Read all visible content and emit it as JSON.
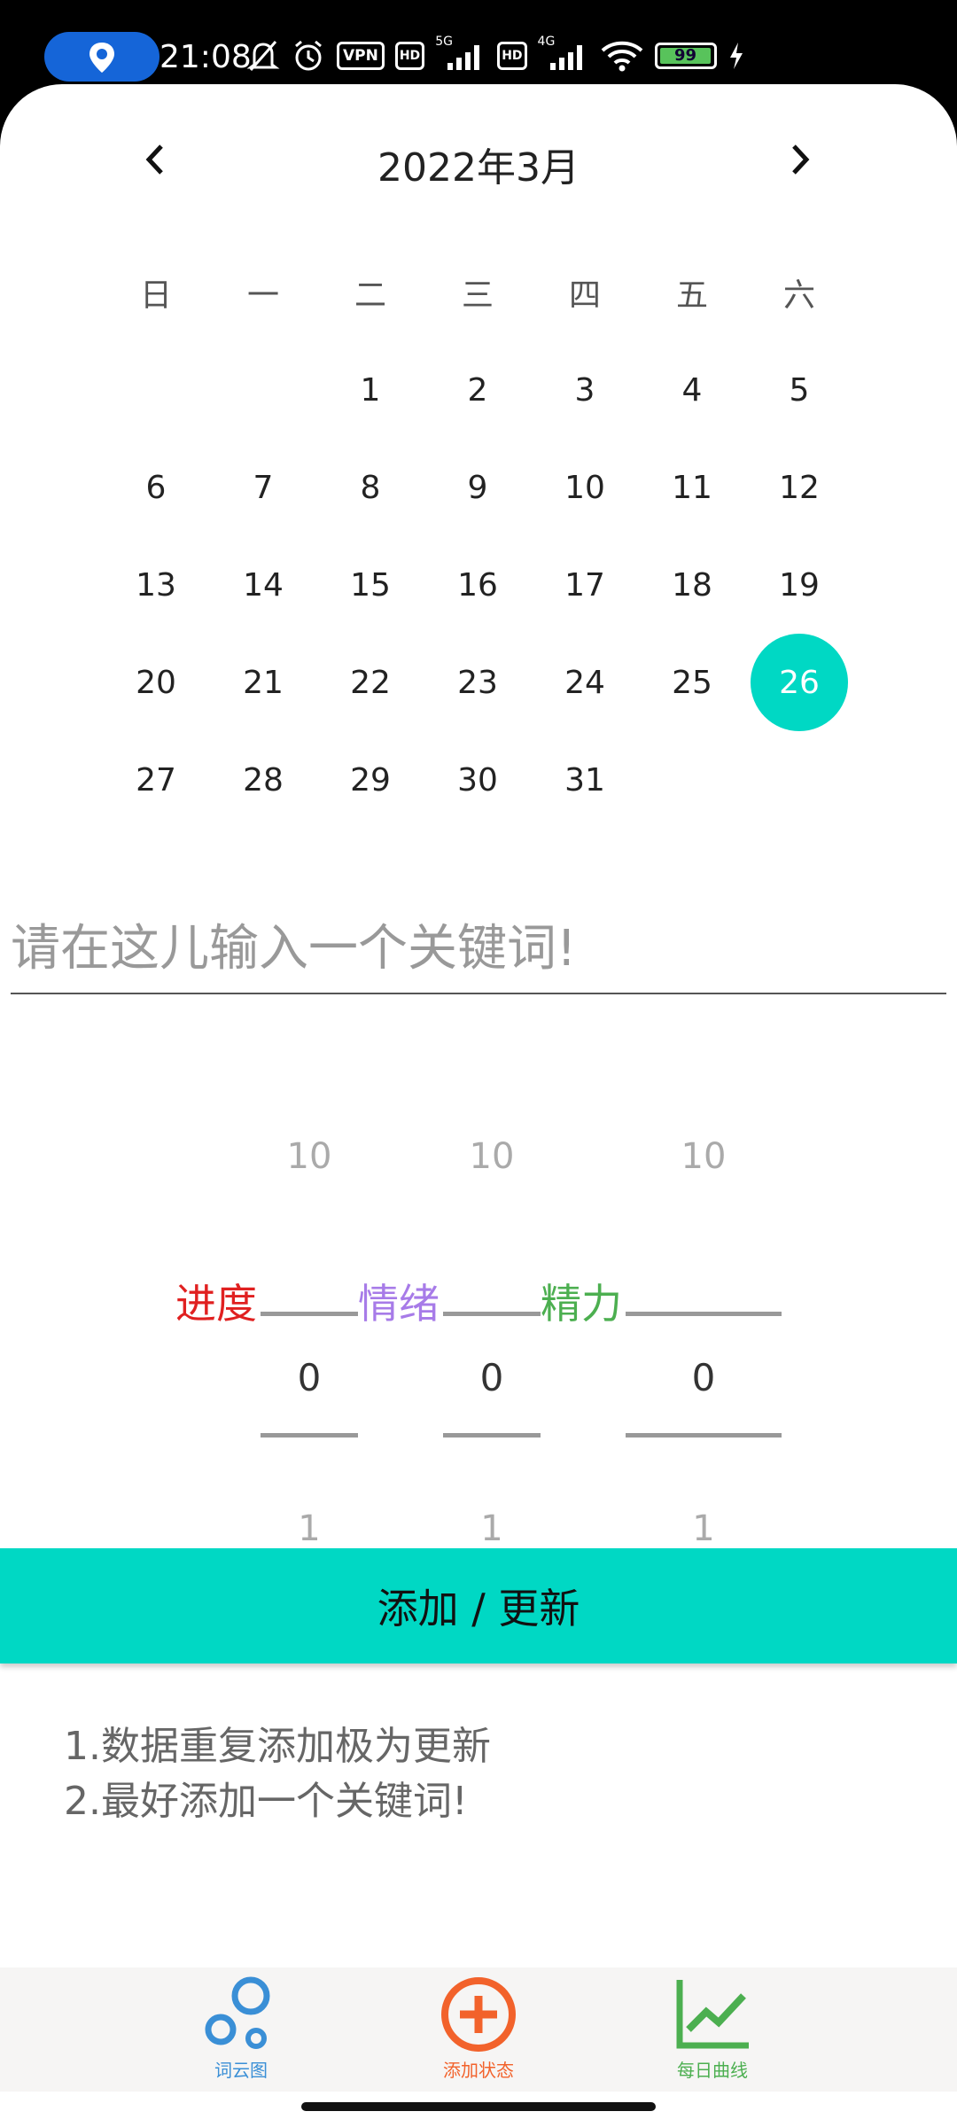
{
  "status_bar": {
    "time": "21:08",
    "vpn_label": "VPN",
    "hd1": "HD",
    "net1": "5G",
    "hd2": "HD",
    "net2": "4G",
    "battery": "99",
    "battery_level": 0.99,
    "pill_color": "#1565d8",
    "icons": [
      "location-icon",
      "mute-bell-icon",
      "alarm-icon",
      "signal-icon",
      "wifi-icon",
      "battery-icon",
      "charging-icon"
    ]
  },
  "calendar": {
    "title": "2022年3月",
    "prev_icon": "chevron-left-icon",
    "next_icon": "chevron-right-icon",
    "weekdays": [
      "日",
      "一",
      "二",
      "三",
      "四",
      "五",
      "六"
    ],
    "weeks": [
      [
        "",
        "",
        "1",
        "2",
        "3",
        "4",
        "5"
      ],
      [
        "6",
        "7",
        "8",
        "9",
        "10",
        "11",
        "12"
      ],
      [
        "13",
        "14",
        "15",
        "16",
        "17",
        "18",
        "19"
      ],
      [
        "20",
        "21",
        "22",
        "23",
        "24",
        "25",
        "26"
      ],
      [
        "27",
        "28",
        "29",
        "30",
        "31",
        "",
        ""
      ]
    ],
    "selected_day": "26",
    "accent": "#00d8c4"
  },
  "keyword_input": {
    "placeholder": "请在这儿输入一个关键词!",
    "value": ""
  },
  "pickers": [
    {
      "label": "进度",
      "label_color": "#e02020",
      "max": "10",
      "value": "0",
      "min": "1"
    },
    {
      "label": "情绪",
      "label_color": "#a77be8",
      "max": "10",
      "value": "0",
      "min": "1"
    },
    {
      "label": "精力",
      "label_color": "#4caf50",
      "max": "10",
      "value": "0",
      "min": "1"
    }
  ],
  "add_button": {
    "label": "添加 / 更新",
    "color": "#00d8c4"
  },
  "notes": [
    "1.数据重复添加极为更新",
    "2.最好添加一个关键词!"
  ],
  "bottom_nav": [
    {
      "label": "词云图",
      "icon": "bubbles-icon",
      "color": "#3a8fd6"
    },
    {
      "label": "添加状态",
      "icon": "plus-circle-icon",
      "color": "#f2622b"
    },
    {
      "label": "每日曲线",
      "icon": "line-chart-icon",
      "color": "#4caf50"
    }
  ]
}
